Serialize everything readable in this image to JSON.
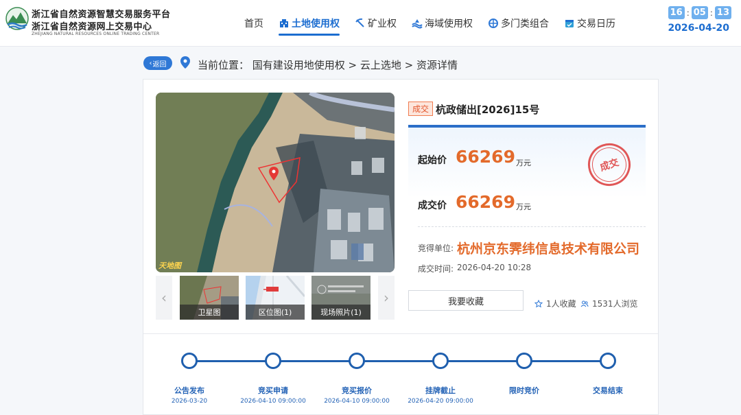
{
  "header": {
    "brand_line1": "浙江省自然资源智慧交易服务平台",
    "brand_line2": "浙江省自然资源网上交易中心",
    "brand_line3": "ZHEJIANG NATURAL RESOURCES ONLINE TRADING CENTER",
    "nav": [
      {
        "label": "首页",
        "icon": "",
        "active": false
      },
      {
        "label": "土地使用权",
        "icon": "building-icon",
        "active": true
      },
      {
        "label": "矿业权",
        "icon": "mining-icon",
        "active": false
      },
      {
        "label": "海域使用权",
        "icon": "wave-icon",
        "active": false
      },
      {
        "label": "多门类组合",
        "icon": "combo-icon",
        "active": false
      },
      {
        "label": "交易日历",
        "icon": "calendar-icon",
        "active": false
      }
    ],
    "clock": {
      "h": "16",
      "m": "05",
      "s": "13"
    },
    "date": "2026-04-20"
  },
  "breadcrumb": {
    "back_label": "返回",
    "text": "当前位置： 国有建设用地使用权 > 云上选地 > 资源详情"
  },
  "gallery": {
    "map_watermark": "天地图",
    "thumbs": [
      {
        "label": "卫星图"
      },
      {
        "label": "区位图(1)"
      },
      {
        "label": "现场照片(1)"
      }
    ]
  },
  "detail": {
    "status_badge": "成交",
    "title": "杭政储出[2026]15号",
    "start_price_label": "起始价",
    "start_price": "66269",
    "deal_price_label": "成交价",
    "deal_price": "66269",
    "unit": "万元",
    "stamp_text": "成交",
    "winner_label": "竞得单位:",
    "winner": "杭州京东霁纬信息技术有限公司",
    "time_label": "成交时间:",
    "time_value": "2026-04-20 10:28",
    "favorite_button": "我要收藏",
    "favorites": "1人收藏",
    "views": "1531人浏览"
  },
  "timeline": [
    {
      "label": "公告发布",
      "date": "2026-03-20"
    },
    {
      "label": "竞买申请",
      "date": "2026-04-10 09:00:00"
    },
    {
      "label": "竞买报价",
      "date": "2026-04-10 09:00:00"
    },
    {
      "label": "挂牌截止",
      "date": "2026-04-20 09:00:00"
    },
    {
      "label": "限时竞价",
      "date": ""
    },
    {
      "label": "交易结束",
      "date": ""
    }
  ],
  "colors": {
    "accent": "#1c6dd0",
    "price": "#e36a2b",
    "stamp": "#e05757"
  }
}
